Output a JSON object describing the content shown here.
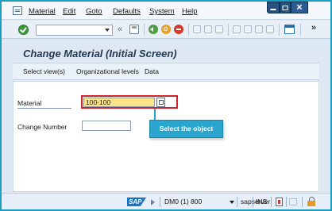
{
  "menu": {
    "items": [
      "Material",
      "Edit",
      "Goto",
      "Defaults",
      "System",
      "Help"
    ]
  },
  "toolbar": {
    "command_field_value": "",
    "nav_glyph": "«"
  },
  "screen": {
    "title": "Change Material (Initial Screen)",
    "app_toolbar": [
      "Select view(s)",
      "Organizational levels",
      "Data"
    ]
  },
  "form": {
    "material_label": "Material",
    "material_value": "100-100",
    "change_number_label": "Change Number",
    "change_number_value": ""
  },
  "callout": {
    "text": "Select the object"
  },
  "status": {
    "sap_logo": "SAP",
    "system": "DM0 (1) 800",
    "server": "sapserver",
    "mode": "INS"
  },
  "colors": {
    "callout": "#29a5ce",
    "highlight_border": "#d2222b",
    "required_field": "#fbe38a",
    "frame": "#1c9fbf"
  },
  "icons": [
    "app-menu-icon",
    "minimize-icon",
    "maximize-icon",
    "close-icon",
    "enter-icon",
    "save-icon",
    "back-icon",
    "exit-icon",
    "cancel-icon",
    "print-icon",
    "find-icon",
    "find-next-icon",
    "first-page-icon",
    "previous-page-icon",
    "next-page-icon",
    "last-page-icon",
    "customize-layout-icon",
    "help-icon",
    "search-help-icon",
    "lock-icon"
  ]
}
